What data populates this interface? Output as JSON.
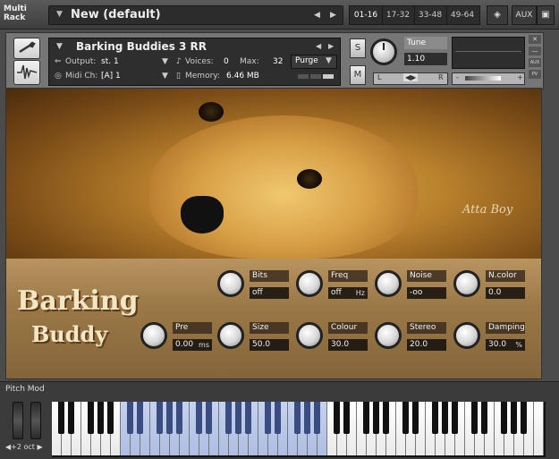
{
  "rack": {
    "label_line1": "Multi",
    "label_line2": "Rack",
    "preset_name": "New (default)",
    "prev_arrow": "◀",
    "next_arrow": "▶",
    "ranges": [
      "01-16",
      "17-32",
      "33-48",
      "49-64"
    ],
    "active_range": "01-16",
    "aux_label": "AUX"
  },
  "instrument": {
    "name": "Barking Buddies 3 RR",
    "output_label": "Output:",
    "output_value": "st. 1",
    "voices_label": "Voices:",
    "voices_value": "0",
    "max_label": "Max:",
    "max_value": "32",
    "purge_label": "Purge",
    "midi_label": "Midi Ch:",
    "midi_value": "[A]  1",
    "memory_label": "Memory:",
    "memory_value": "6.46 MB",
    "solo_label": "S",
    "mute_label": "M",
    "tune_label": "Tune",
    "tune_value": "1.10",
    "pan_left": "L",
    "pan_center": "◀▶",
    "pan_right": "R",
    "vol_minus": "-",
    "vol_plus": "+",
    "close_label": "✕",
    "min_label": "—",
    "aux_side": "AUX",
    "pv_side": "PV"
  },
  "art": {
    "title_line1": "Barking",
    "title_line2": "Buddy",
    "logo_text": "Atta Boy"
  },
  "controls": [
    {
      "label": "Bits",
      "value": "off",
      "unit": ""
    },
    {
      "label": "Freq",
      "value": "off",
      "unit": "Hz"
    },
    {
      "label": "Noise",
      "value": "-oo",
      "unit": ""
    },
    {
      "label": "N.color",
      "value": "0.0",
      "unit": ""
    },
    {
      "label": "Pre",
      "value": "0.00",
      "unit": "ms"
    },
    {
      "label": "Size",
      "value": "50.0",
      "unit": ""
    },
    {
      "label": "Colour",
      "value": "30.0",
      "unit": ""
    },
    {
      "label": "Stereo",
      "value": "20.0",
      "unit": ""
    },
    {
      "label": "Damping",
      "value": "30.0",
      "unit": "%"
    }
  ],
  "bottom": {
    "pitch_mod_label": "Pitch Mod",
    "octave_label": "◀+2 oct ▶"
  },
  "colors": {
    "highlight_keys": "#aebde2",
    "panel_wood": "#9a7846",
    "fur": "#d8a046"
  }
}
